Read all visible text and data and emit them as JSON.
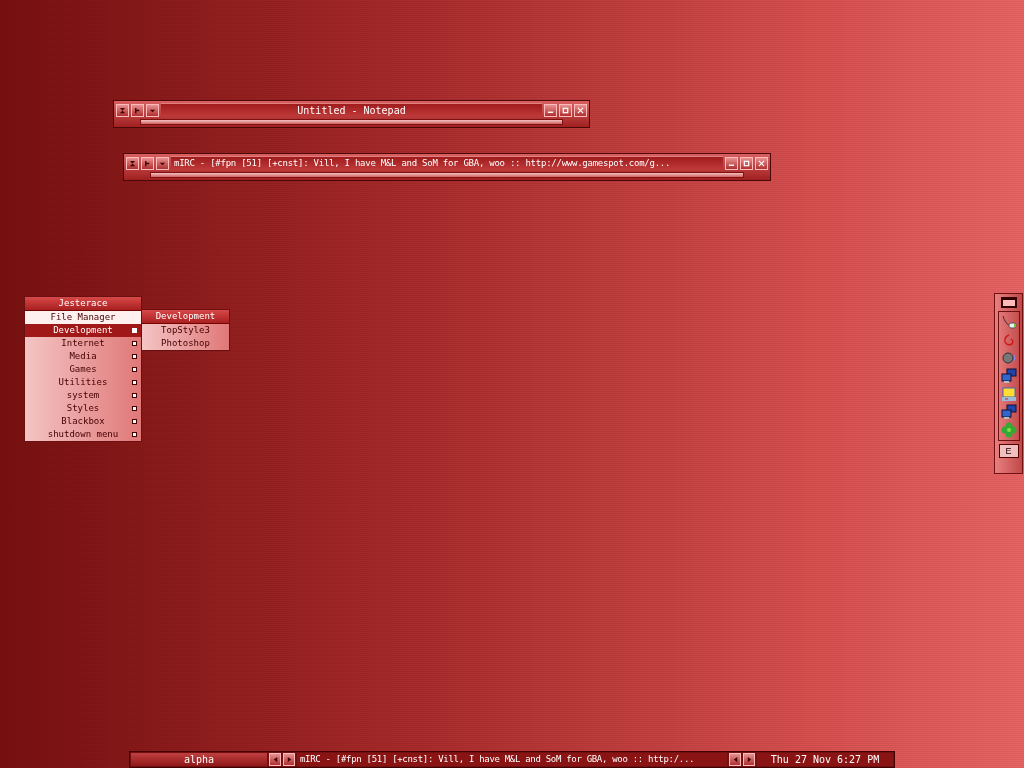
{
  "windows": [
    {
      "title": "Untitled - Notepad",
      "left": false
    },
    {
      "title": "mIRC - [#fpn [51] [+cnst]: Vill, I have M&L and SoM for GBA, woo :: http://www.gamespot.com/g...",
      "left": true
    }
  ],
  "menu": {
    "title": "Jesterace",
    "items": [
      {
        "label": "File Manager",
        "hovered": true,
        "selected": false,
        "submenu": false
      },
      {
        "label": "Development",
        "hovered": false,
        "selected": true,
        "submenu": true
      },
      {
        "label": "Internet",
        "hovered": false,
        "selected": false,
        "submenu": true
      },
      {
        "label": "Media",
        "hovered": false,
        "selected": false,
        "submenu": true
      },
      {
        "label": "Games",
        "hovered": false,
        "selected": false,
        "submenu": true
      },
      {
        "label": "Utilities",
        "hovered": false,
        "selected": false,
        "submenu": true
      },
      {
        "label": "system",
        "hovered": false,
        "selected": false,
        "submenu": true
      },
      {
        "label": "Styles",
        "hovered": false,
        "selected": false,
        "submenu": true
      },
      {
        "label": "Blackbox",
        "hovered": false,
        "selected": false,
        "submenu": true
      },
      {
        "label": "shutdown menu",
        "hovered": false,
        "selected": false,
        "submenu": true
      }
    ]
  },
  "submenu": {
    "title": "Development",
    "items": [
      "TopStyle3",
      "Photoshop"
    ]
  },
  "slit": {
    "button": "E"
  },
  "toolbar": {
    "workspace": "alpha",
    "window_title": "mIRC - [#fpn [51] [+cnst]: Vill, I have M&L and SoM for GBA, woo :: http:/...",
    "clock": "Thu 27 Nov 6:27 PM"
  }
}
